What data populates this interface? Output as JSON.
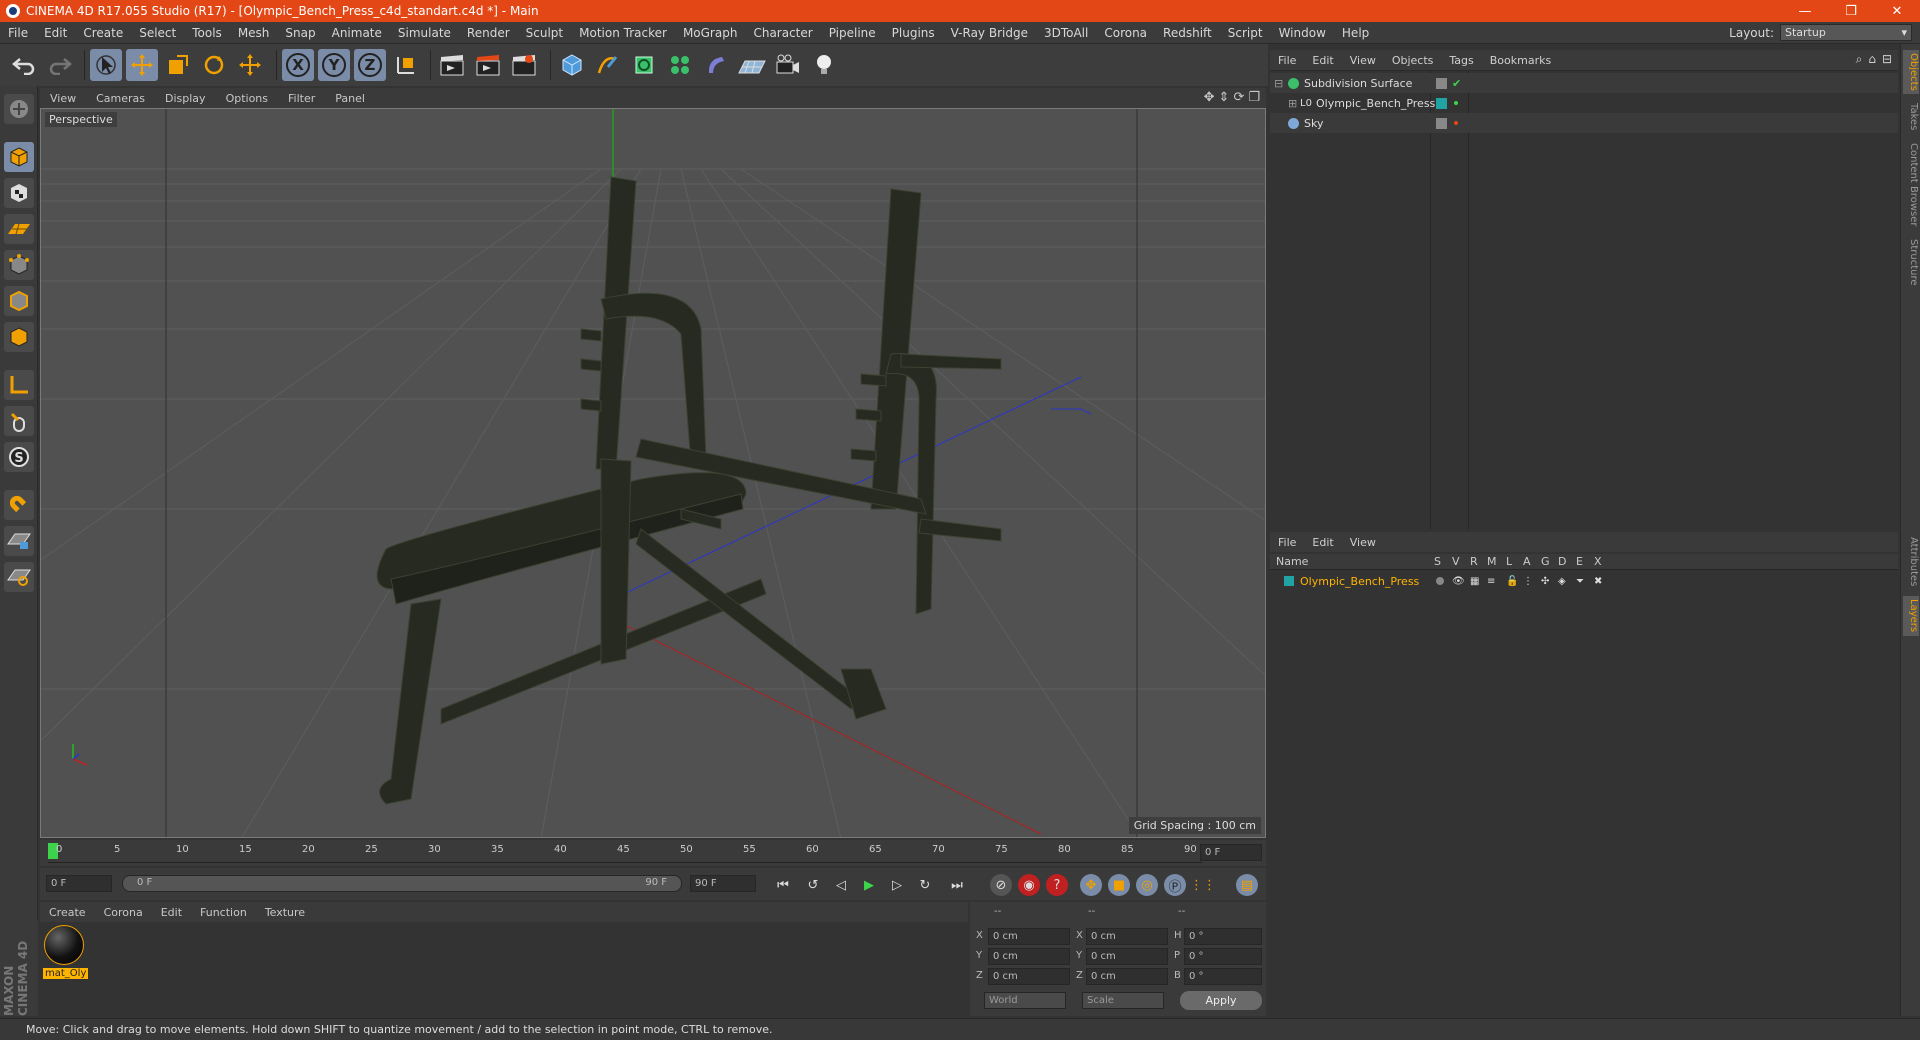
{
  "window": {
    "title": "CINEMA 4D R17.055 Studio (R17) - [Olympic_Bench_Press_c4d_standart.c4d *] - Main",
    "controls": [
      "—",
      "❐",
      "✕"
    ]
  },
  "menubar": {
    "items": [
      "File",
      "Edit",
      "Create",
      "Select",
      "Tools",
      "Mesh",
      "Snap",
      "Animate",
      "Simulate",
      "Render",
      "Sculpt",
      "Motion Tracker",
      "MoGraph",
      "Character",
      "Pipeline",
      "Plugins",
      "V-Ray Bridge",
      "3DToAll",
      "Corona",
      "Redshift",
      "Script",
      "Window",
      "Help"
    ],
    "layout_label": "Layout:",
    "layout_value": "Startup"
  },
  "toolbar": {
    "axis_x": "X",
    "axis_y": "Y",
    "axis_z": "Z"
  },
  "viewport": {
    "menu": [
      "View",
      "Cameras",
      "Display",
      "Options",
      "Filter",
      "Panel"
    ],
    "label": "Perspective",
    "grid_spacing": "Grid Spacing : 100 cm"
  },
  "timeline": {
    "ticks": [
      "0",
      "5",
      "10",
      "15",
      "20",
      "25",
      "30",
      "35",
      "40",
      "45",
      "50",
      "55",
      "60",
      "65",
      "70",
      "75",
      "80",
      "85",
      "90"
    ],
    "current_frame": "0 F",
    "start_frame": "0 F",
    "range_start": "0 F",
    "range_end": "90 F",
    "end_frame": "90 F"
  },
  "materials": {
    "menu": [
      "Create",
      "Corona",
      "Edit",
      "Function",
      "Texture"
    ],
    "items": [
      {
        "name": "mat_Oly"
      }
    ]
  },
  "coordinates": {
    "headers": [
      "--",
      "--",
      "--"
    ],
    "rows": [
      {
        "a": "X",
        "av": "0 cm",
        "b": "X",
        "bv": "0 cm",
        "c": "H",
        "cv": "0 °"
      },
      {
        "a": "Y",
        "av": "0 cm",
        "b": "Y",
        "bv": "0 cm",
        "c": "P",
        "cv": "0 °"
      },
      {
        "a": "Z",
        "av": "0 cm",
        "b": "Z",
        "bv": "0 cm",
        "c": "B",
        "cv": "0 °"
      }
    ],
    "mode_world": "World",
    "mode_scale": "Scale",
    "apply": "Apply"
  },
  "objects": {
    "menu": [
      "File",
      "Edit",
      "View",
      "Objects",
      "Tags",
      "Bookmarks"
    ],
    "items": [
      {
        "name": "Subdivision Surface"
      },
      {
        "name": "Olympic_Bench_Press"
      },
      {
        "name": "Sky"
      }
    ]
  },
  "layers": {
    "menu": [
      "File",
      "Edit",
      "View"
    ],
    "name_header": "Name",
    "columns": [
      "S",
      "V",
      "R",
      "M",
      "L",
      "A",
      "G",
      "D",
      "E",
      "X"
    ],
    "items": [
      {
        "name": "Olympic_Bench_Press"
      }
    ]
  },
  "right_tabs": [
    "Objects",
    "Takes",
    "Content Browser",
    "Structure",
    "Attributes",
    "Layers"
  ],
  "branding": "MAXON CINEMA 4D",
  "status": "Move: Click and drag to move elements. Hold down SHIFT to quantize movement / add to the selection in point mode, CTRL to remove.",
  "colors": {
    "titlebar": "#e44716",
    "accent_orange": "#f0a000",
    "selection": "#ffb400",
    "layer_teal": "#22a3a3"
  }
}
